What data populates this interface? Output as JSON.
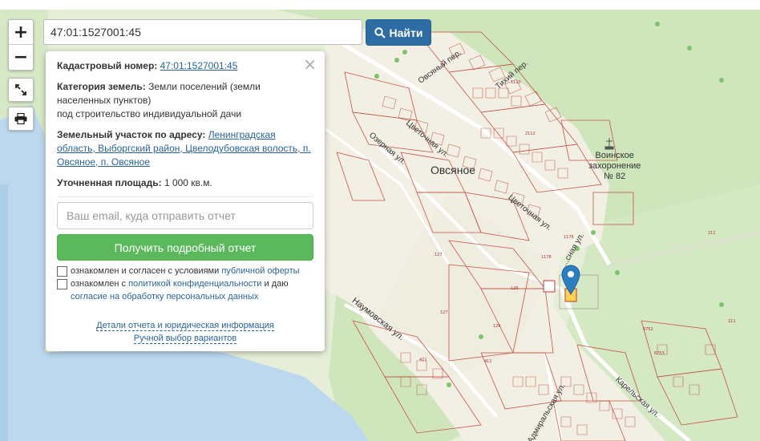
{
  "search": {
    "value": "47:01:1527001:45",
    "button_label": "Найти"
  },
  "zoom": {
    "plus": "+",
    "minus": "−"
  },
  "icons": {
    "search": "search-icon",
    "fullscreen": "fullscreen-icon",
    "print": "print-icon",
    "close": "close-icon",
    "marker": "map-marker-icon"
  },
  "popup": {
    "close": "×",
    "cadastral_label": "Кадастровый номер:",
    "cadastral_number": "47:01:1527001:45",
    "category_label": "Категория земель:",
    "category_value_1": "Земли поселений (земли",
    "category_value_2": "населенных пунктов)",
    "category_value_3": "под строительство индивидуальной дачи",
    "address_label": "Земельный участок по адресу:",
    "address_value_1": "Ленинградская",
    "address_value_2": "область, Выборгский район, Цвелодубовская волость, п.",
    "address_value_3": "Овсяное, п. Овсяное",
    "area_label": "Уточненная площадь:",
    "area_value": "1 000 кв.м.",
    "email_placeholder": "Ваш email, куда отправить отчет",
    "report_button": "Получить подробный отчет",
    "consent1_text": "ознакомлен и согласен с условиями",
    "consent1_link": "публичной оферты",
    "consent2_text_a": "ознакомлен с",
    "consent2_link_a": "политикой конфиденциальности",
    "consent2_text_b": "и даю",
    "consent2_link_b": "согласие на обработку персональных данных",
    "details_link": "Детали отчета и юридическая информация",
    "manual_link": "Ручной выбор вариантов"
  },
  "map": {
    "village": "Овсяное",
    "cemetery_1": "Воинское",
    "cemetery_2": "захоронение",
    "cemetery_3": "№ 82",
    "streets": {
      "ovsyany_per": "Овсяный пер.",
      "tikhy_per": "Тихий пер.",
      "tsvetochnaya_1": "Цветочная ул.",
      "tsvetochnaya_2": "Цветочная ул.",
      "ozernaya": "Озерная ул.",
      "naumovskaya": "Наумовская ул.",
      "lesnaya": "...сная ул.",
      "karelskaya": "Карельская ул.",
      "admiralskaya": "Адмиральская ул."
    },
    "plots": [
      "127",
      "127",
      "126",
      "126",
      "211",
      "211",
      "6752",
      "6753",
      "411",
      "421",
      "2112",
      "1176",
      "1110",
      "1178"
    ],
    "colors": {
      "land": "#e7eed8",
      "forest": "#c8e3b5",
      "water": "#bcd8ee",
      "plot_border": "#c0392b",
      "road": "#ffffff",
      "marker": "#2a7fc1"
    }
  }
}
